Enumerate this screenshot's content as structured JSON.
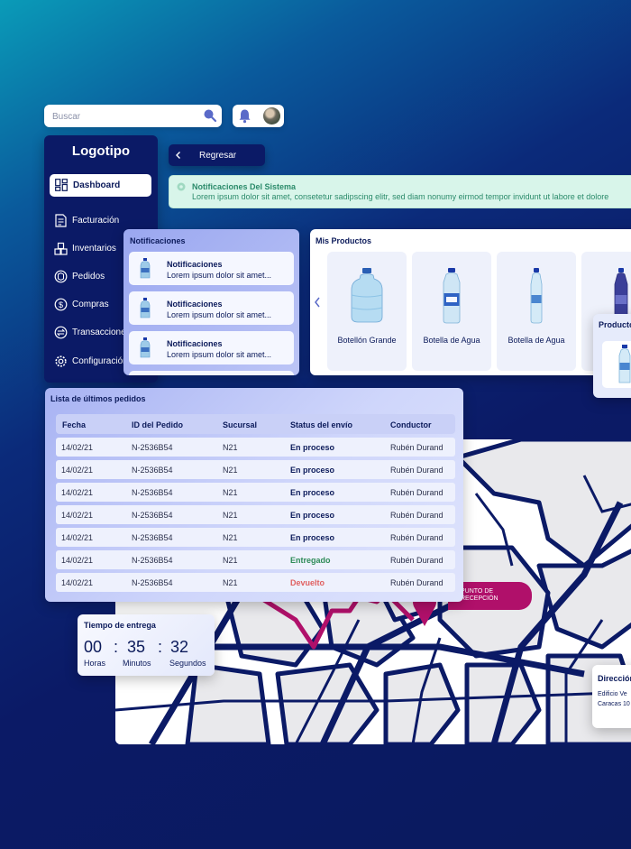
{
  "search": {
    "placeholder": "Buscar",
    "icon": "search-icon"
  },
  "header": {
    "bell_icon": "bell-icon",
    "avatar": "user-avatar"
  },
  "sidebar": {
    "logo": "Logotipo",
    "items": [
      {
        "label": "Dashboard",
        "icon": "dashboard-icon",
        "active": true
      },
      {
        "label": "Facturación",
        "icon": "invoice-icon"
      },
      {
        "label": "Inventarios",
        "icon": "inventory-icon"
      },
      {
        "label": "Pedidos",
        "icon": "orders-icon"
      },
      {
        "label": "Compras",
        "icon": "dollar-icon"
      },
      {
        "label": "Transacciones",
        "icon": "transactions-icon"
      },
      {
        "label": "Configuración",
        "icon": "gear-icon"
      }
    ]
  },
  "back_button": {
    "label": "Regresar"
  },
  "system_notification": {
    "title": "Notificaciones Del Sistema",
    "body": "Lorem ipsum dolor sit amet, consetetur sadipscing elitr, sed diam nonumy eirmod tempor invidunt ut labore et dolore"
  },
  "notifications": {
    "title": "Notificaciones",
    "items": [
      {
        "title": "Notificaciones",
        "body": "Lorem ipsum dolor sit amet..."
      },
      {
        "title": "Notificaciones",
        "body": "Lorem ipsum dolor sit amet..."
      },
      {
        "title": "Notificaciones",
        "body": "Lorem ipsum dolor sit amet..."
      }
    ]
  },
  "products": {
    "title": "Mis Productos",
    "items": [
      {
        "name": "Botellón Grande"
      },
      {
        "name": "Botella de Agua"
      },
      {
        "name": "Botella de Agua"
      },
      {
        "name": ""
      }
    ],
    "side_title": "Productos"
  },
  "orders": {
    "title": "Lista de últimos pedidos",
    "columns": [
      "Fecha",
      "ID del Pedido",
      "Sucursal",
      "Status del envío",
      "Conductor"
    ],
    "rows": [
      [
        "14/02/21",
        "N-2536B54",
        "N21",
        "En proceso",
        "Rubén Durand"
      ],
      [
        "14/02/21",
        "N-2536B54",
        "N21",
        "En proceso",
        "Rubén Durand"
      ],
      [
        "14/02/21",
        "N-2536B54",
        "N21",
        "En proceso",
        "Rubén Durand"
      ],
      [
        "14/02/21",
        "N-2536B54",
        "N21",
        "En proceso",
        "Rubén Durand"
      ],
      [
        "14/02/21",
        "N-2536B54",
        "N21",
        "En proceso",
        "Rubén Durand"
      ],
      [
        "14/02/21",
        "N-2536B54",
        "N21",
        "Entregado",
        "Rubén Durand"
      ],
      [
        "14/02/21",
        "N-2536B54",
        "N21",
        "Devuelto",
        "Rubén Durand"
      ]
    ]
  },
  "delivery_time": {
    "title": "Tiempo de entrega",
    "hours": "00",
    "minutes": "35",
    "seconds": "32",
    "hours_label": "Horas",
    "minutes_label": "Minutos",
    "seconds_label": "Segundos"
  },
  "map": {
    "pickup_label": "PUNTO DE RECEPCIÓN",
    "address_title": "Dirección",
    "address_line1": "Edificio Ve",
    "address_line2": "Caracas 10"
  },
  "colors": {
    "navy": "#0b1a66",
    "accent_magenta": "#b0106a",
    "status_delivered": "#2e8b57",
    "status_returned": "#e06060"
  }
}
